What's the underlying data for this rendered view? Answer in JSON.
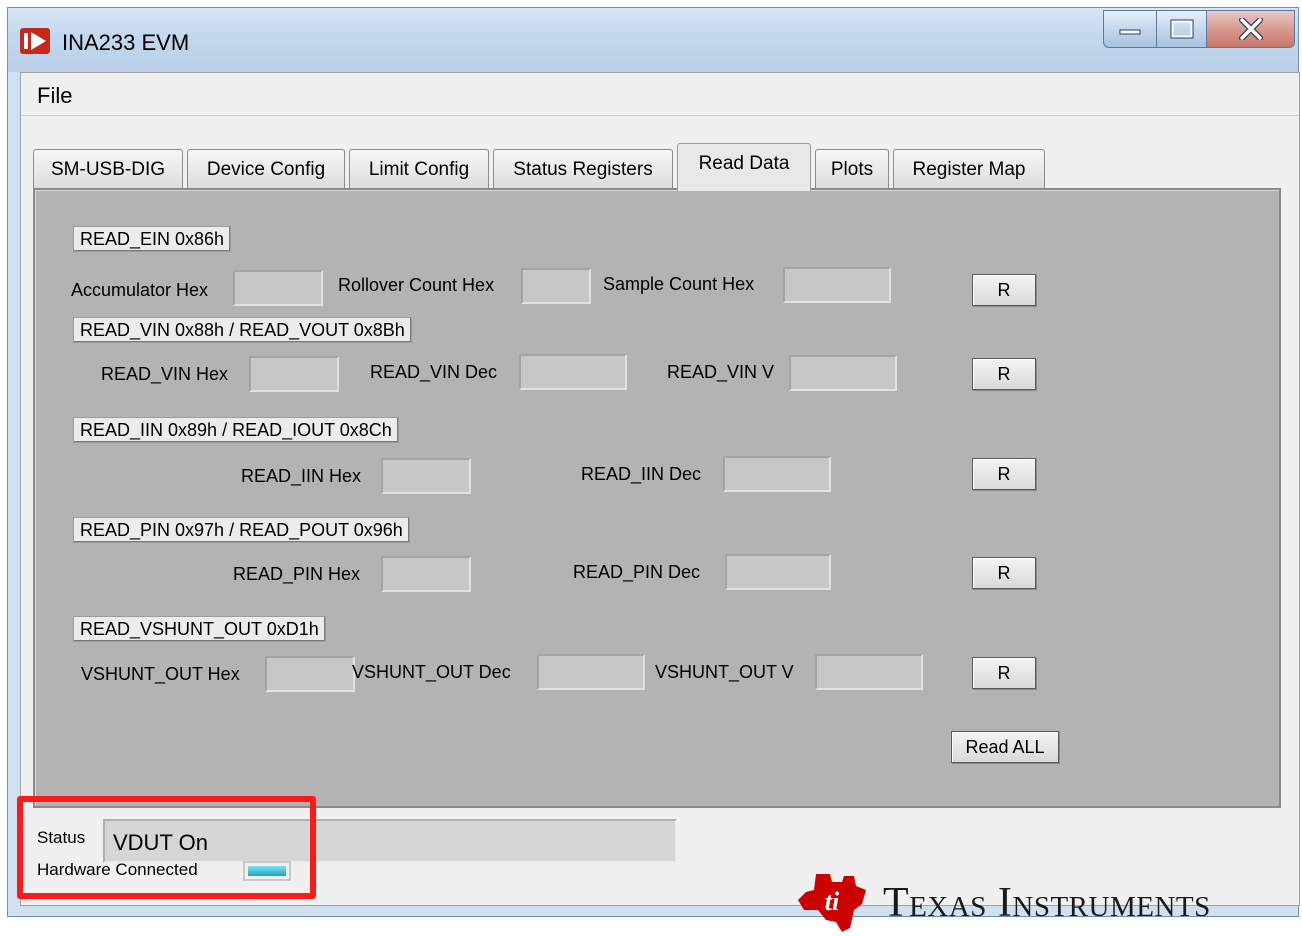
{
  "window": {
    "title": "INA233 EVM",
    "app_icon": "app-icon"
  },
  "menubar": {
    "file": "File"
  },
  "tabs": [
    {
      "label": "SM-USB-DIG"
    },
    {
      "label": "Device Config"
    },
    {
      "label": "Limit Config"
    },
    {
      "label": "Status Registers"
    },
    {
      "label": "Read Data",
      "active": true
    },
    {
      "label": "Plots"
    },
    {
      "label": "Register Map"
    }
  ],
  "read_data": {
    "ein": {
      "section": "READ_EIN 0x86h",
      "accumulator_hex": "Accumulator Hex",
      "rollover_count_hex": "Rollover Count Hex",
      "sample_count_hex": "Sample Count Hex",
      "accumulator_value": "",
      "rollover_value": "",
      "sample_value": "",
      "read": "R"
    },
    "vin": {
      "section": "READ_VIN 0x88h / READ_VOUT 0x8Bh",
      "hex": "READ_VIN Hex",
      "dec": "READ_VIN Dec",
      "v": "READ_VIN V",
      "hex_value": "",
      "dec_value": "",
      "v_value": "",
      "read": "R"
    },
    "iin": {
      "section": "READ_IIN 0x89h / READ_IOUT 0x8Ch",
      "hex": "READ_IIN Hex",
      "dec": "READ_IIN Dec",
      "hex_value": "",
      "dec_value": "",
      "read": "R"
    },
    "pin": {
      "section": "READ_PIN 0x97h / READ_POUT 0x96h",
      "hex": "READ_PIN Hex",
      "dec": "READ_PIN Dec",
      "hex_value": "",
      "dec_value": "",
      "read": "R"
    },
    "vshunt": {
      "section": "READ_VSHUNT_OUT 0xD1h",
      "hex": "VSHUNT_OUT Hex",
      "dec": "VSHUNT_OUT Dec",
      "v": "VSHUNT_OUT V",
      "hex_value": "",
      "dec_value": "",
      "v_value": "",
      "read": "R"
    },
    "read_all": "Read ALL"
  },
  "status": {
    "label": "Status",
    "value": "VDUT On",
    "hardware_label": "Hardware Connected",
    "hardware_connected": true
  },
  "branding": {
    "company": "Texas Instruments"
  },
  "colors": {
    "panel": "#b3b3b3",
    "highlight": "#ff1a1a",
    "led_on": "#1aa8c2",
    "ti_red": "#cc0000"
  }
}
